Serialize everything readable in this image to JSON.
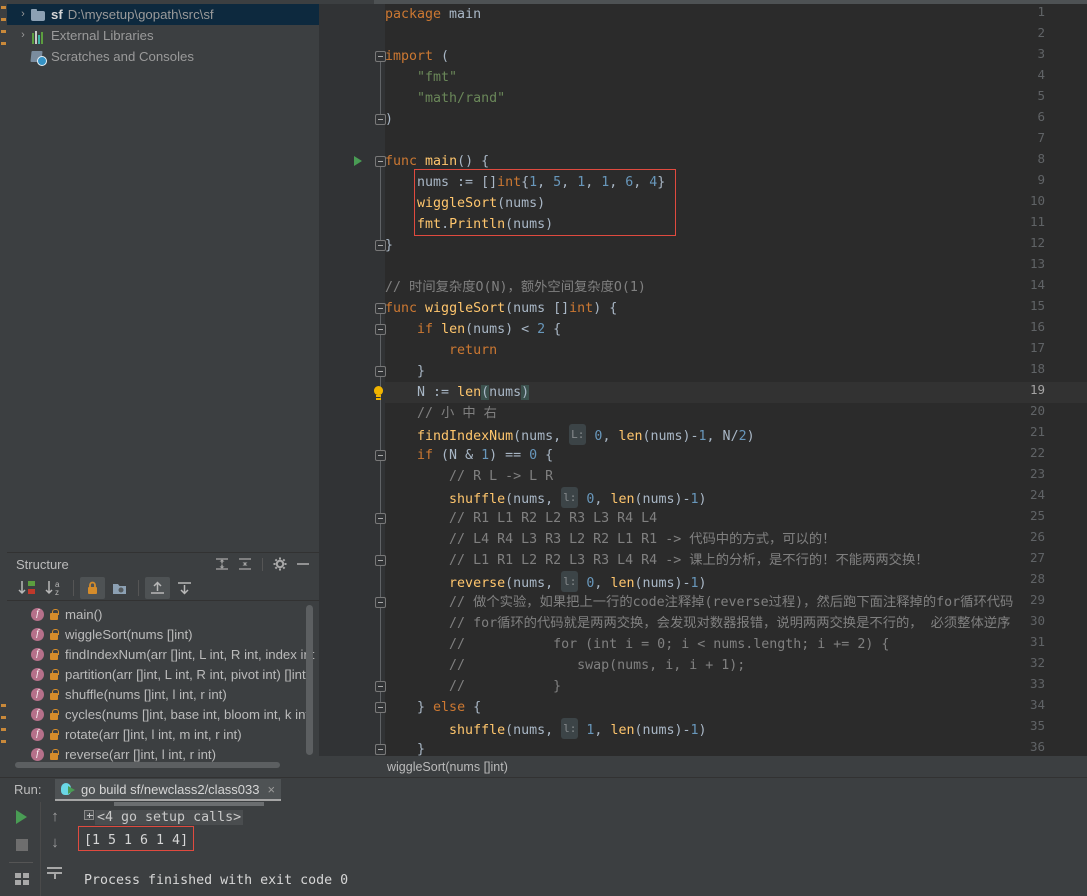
{
  "project": {
    "tree": [
      {
        "arrow": "›",
        "icon": "folder-icon",
        "name": "sf",
        "path": "D:\\mysetup\\gopath\\src\\sf",
        "selected": true
      },
      {
        "arrow": "›",
        "icon": "external-libraries-icon",
        "name": "",
        "path": "External Libraries",
        "selected": false
      },
      {
        "arrow": "",
        "icon": "scratches-icon",
        "name": "",
        "path": "Scratches and Consoles",
        "selected": false
      }
    ]
  },
  "structure": {
    "title": "Structure",
    "header_actions": [
      "expand-all-icon",
      "collapse-all-icon",
      "gear-icon",
      "minimize-icon"
    ],
    "toolbar_buttons": [
      "sort-by-visibility-icon",
      "sort-alphabetically-icon",
      "show-non-public-icon",
      "group-by-file-icon",
      "scroll-from-source-icon",
      "scroll-to-source-icon"
    ],
    "items": [
      {
        "label": "main()"
      },
      {
        "label": "wiggleSort(nums []int)"
      },
      {
        "label": "findIndexNum(arr []int, L int, R int, index int"
      },
      {
        "label": "partition(arr []int, L int, R int, pivot int) []int"
      },
      {
        "label": "shuffle(nums []int, l int, r int)"
      },
      {
        "label": "cycles(nums []int, base int, bloom int, k int)"
      },
      {
        "label": "rotate(arr []int, l int, m int, r int)"
      },
      {
        "label": "reverse(arr []int, l int, r int)"
      }
    ]
  },
  "editor": {
    "breadcrumb": "wiggleSort(nums []int)",
    "current_line": 19,
    "run_marker_line": 8,
    "bulb_line": 19,
    "highlight_color": "#e04a3f",
    "first_line": 1,
    "last_line": 36,
    "lines": [
      {
        "n": 1,
        "html": "<span class=\"kw\">package</span> main"
      },
      {
        "n": 2,
        "html": ""
      },
      {
        "n": 3,
        "html": "<span class=\"kw\">import</span> ("
      },
      {
        "n": 4,
        "html": "    <span class=\"str\">\"fmt\"</span>"
      },
      {
        "n": 5,
        "html": "    <span class=\"str\">\"math/rand\"</span>"
      },
      {
        "n": 6,
        "html": ")"
      },
      {
        "n": 7,
        "html": ""
      },
      {
        "n": 8,
        "html": "<span class=\"kw\">func</span> <span class=\"fn\">main</span>() {"
      },
      {
        "n": 9,
        "html": "    nums := []<span class=\"kw\">int</span>{<span class=\"num\">1</span>, <span class=\"num\">5</span>, <span class=\"num\">1</span>, <span class=\"num\">1</span>, <span class=\"num\">6</span>, <span class=\"num\">4</span>}"
      },
      {
        "n": 10,
        "html": "    <span class=\"fn\">wiggleSort</span>(nums)"
      },
      {
        "n": 11,
        "html": "    <span class=\"fn\">fmt</span>.<span class=\"fn\">Println</span>(nums)"
      },
      {
        "n": 12,
        "html": "}"
      },
      {
        "n": 13,
        "html": ""
      },
      {
        "n": 14,
        "html": "<span class=\"com\">// 时间复杂度O(N)，额外空间复杂度O(1)</span>"
      },
      {
        "n": 15,
        "html": "<span class=\"kw\">func</span> <span class=\"fn\">wiggleSort</span>(nums []<span class=\"kw\">int</span>) {"
      },
      {
        "n": 16,
        "html": "    <span class=\"kw\">if</span> <span class=\"fn\">len</span>(nums) &lt; <span class=\"num\">2</span> {"
      },
      {
        "n": 17,
        "html": "        <span class=\"kw\">return</span>"
      },
      {
        "n": 18,
        "html": "    }"
      },
      {
        "n": 19,
        "html": "    N := <span class=\"fn\">len</span><span class=\"bm\">(</span>nums<span class=\"bm\">)</span>"
      },
      {
        "n": 20,
        "html": "    <span class=\"com\">// 小 中 右</span>"
      },
      {
        "n": 21,
        "html": "    <span class=\"fn\">findIndexNum</span>(nums, <span class=\"hint\">L:</span> <span class=\"num\">0</span>, <span class=\"fn\">len</span>(nums)-<span class=\"num\">1</span>, N/<span class=\"num\">2</span>)"
      },
      {
        "n": 22,
        "html": "    <span class=\"kw\">if</span> (N &amp; <span class=\"num\">1</span>) == <span class=\"num\">0</span> {"
      },
      {
        "n": 23,
        "html": "        <span class=\"com\">// R L -&gt; L R</span>"
      },
      {
        "n": 24,
        "html": "        <span class=\"fn\">shuffle</span>(nums, <span class=\"hint\">l:</span> <span class=\"num\">0</span>, <span class=\"fn\">len</span>(nums)-<span class=\"num\">1</span>)"
      },
      {
        "n": 25,
        "html": "        <span class=\"com\">// R1 L1 R2 L2 R3 L3 R4 L4</span>"
      },
      {
        "n": 26,
        "html": "        <span class=\"com\">// L4 R4 L3 R3 L2 R2 L1 R1 -&gt; 代码中的方式，可以的！</span>"
      },
      {
        "n": 27,
        "html": "        <span class=\"com\">// L1 R1 L2 R2 L3 R3 L4 R4 -&gt; 课上的分析，是不行的！不能两两交换！</span>"
      },
      {
        "n": 28,
        "html": "        <span class=\"fn\">reverse</span>(nums, <span class=\"hint\">l:</span> <span class=\"num\">0</span>, <span class=\"fn\">len</span>(nums)-<span class=\"num\">1</span>)"
      },
      {
        "n": 29,
        "html": "        <span class=\"com\">// 做个实验，如果把上一行的code注释掉(reverse过程)，然后跑下面注释掉的for循环代码</span>"
      },
      {
        "n": 30,
        "html": "        <span class=\"com\">// for循环的代码就是两两交换，会发现对数器报错，说明两两交换是不行的， 必须整体逆序</span>"
      },
      {
        "n": 31,
        "html": "        <span class=\"com\">//           for (int i = 0; i &lt; nums.length; i += 2) {</span>"
      },
      {
        "n": 32,
        "html": "        <span class=\"com\">//              swap(nums, i, i + 1);</span>"
      },
      {
        "n": 33,
        "html": "        <span class=\"com\">//           }</span>"
      },
      {
        "n": 34,
        "html": "    } <span class=\"kw\">else</span> {"
      },
      {
        "n": 35,
        "html": "        <span class=\"fn\">shuffle</span>(nums, <span class=\"hint\">l:</span> <span class=\"num\">1</span>, <span class=\"fn\">len</span>(nums)-<span class=\"num\">1</span>)"
      },
      {
        "n": 36,
        "html": "    }"
      }
    ]
  },
  "run": {
    "label": "Run:",
    "tab_title": "go build sf/newclass2/class033",
    "tab_close": "×",
    "side_buttons": [
      "rerun-icon",
      "stop-icon",
      "layout-icon"
    ],
    "side_buttons2": [
      "scroll-up-icon",
      "scroll-down-icon",
      "soft-wrap-icon"
    ],
    "console": {
      "setup_line": "<4 go setup calls>",
      "output_line": "[1 5 1 6 1 4]",
      "exit_line": "Process finished with exit code 0",
      "highlight_color": "#e04a3f"
    }
  }
}
